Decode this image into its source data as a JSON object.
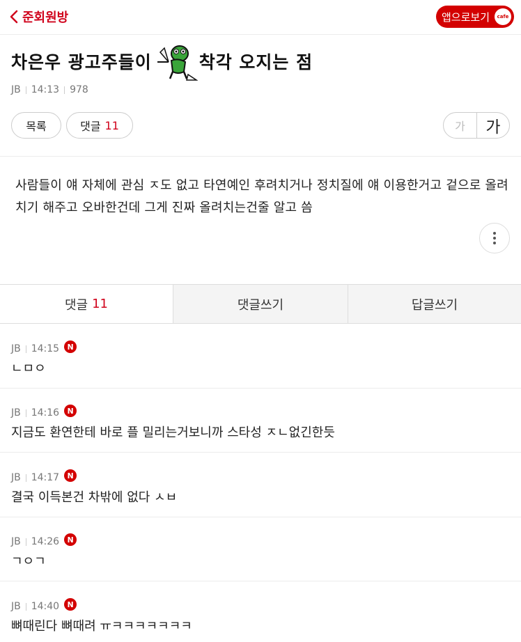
{
  "header": {
    "back_label": "준회원방",
    "app_button_label": "앱으로보기",
    "cafe_badge": "cafe"
  },
  "post": {
    "title_before": "차은우 광고주들이",
    "title_after": "착각 오지는 점",
    "emoticon": "green-frog-emoticon",
    "author": "JB",
    "time": "14:13",
    "views": "978",
    "list_button": "목록",
    "comments_button_label": "댓글",
    "comments_count": "11",
    "font_small": "가",
    "font_large": "가",
    "body": "사람들이 얘 자체에 관심 ㅈ도 없고 타연예인 후려치거나 정치질에 얘 이용한거고 겉으로 올려치기 해주고 오바한건데 그게 진짜 올려치는건줄 알고 씀"
  },
  "tabs": {
    "comments_label": "댓글",
    "comments_count": "11",
    "write_comment": "댓글쓰기",
    "write_reply": "답글쓰기"
  },
  "comments": [
    {
      "author": "JB",
      "time": "14:15",
      "badge": "N",
      "text": "ㄴㅁㅇ"
    },
    {
      "author": "JB",
      "time": "14:16",
      "badge": "N",
      "text": "지금도 환연한테 바로 플 밀리는거보니까 스타성 ㅈㄴ없긴한듯"
    },
    {
      "author": "JB",
      "time": "14:17",
      "badge": "N",
      "text": "결국 이득본건 차밖에 없다 ㅅㅂ"
    },
    {
      "author": "JB",
      "time": "14:26",
      "badge": "N",
      "text": "ㄱㅇㄱ"
    },
    {
      "author": "JB",
      "time": "14:40",
      "badge": "N",
      "text": "뼈때린다 뼈때려 ㅠㅋㅋㅋㅋㅋㅋㅋ"
    }
  ],
  "colors": {
    "accent": "#d30000",
    "count": "#d0021b"
  }
}
